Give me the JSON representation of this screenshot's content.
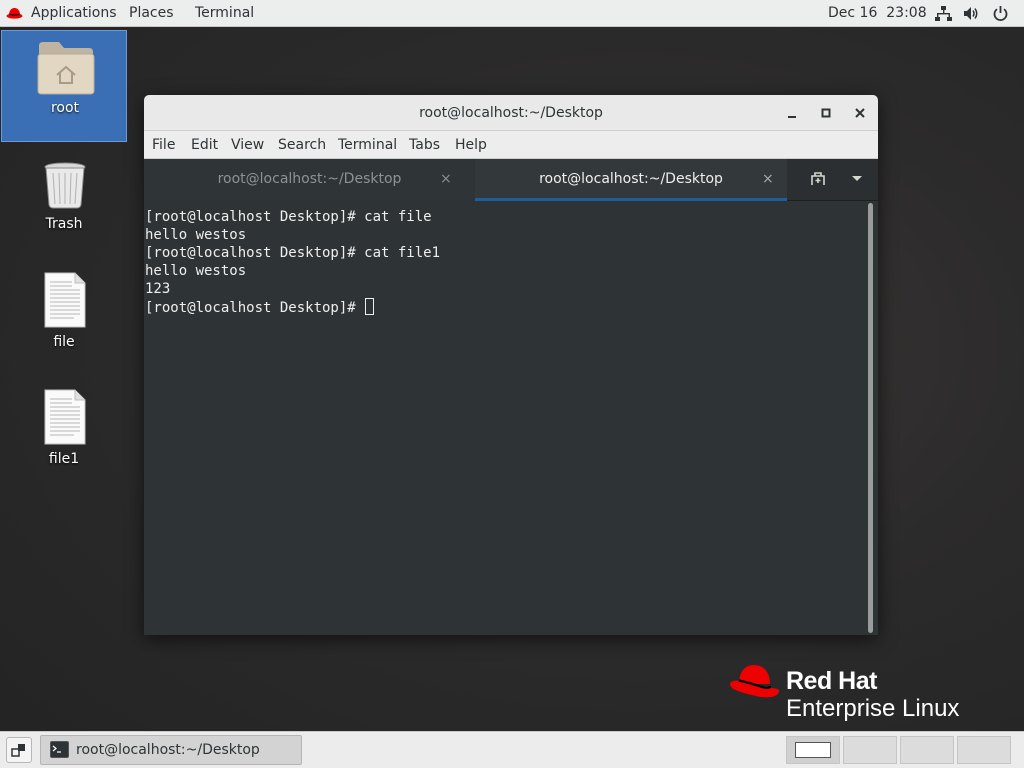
{
  "topbar": {
    "applications": "Applications",
    "places": "Places",
    "terminal": "Terminal",
    "clock": "Dec 16  23:08",
    "icons": [
      "network-icon",
      "volume-icon",
      "power-icon"
    ]
  },
  "desktop": {
    "icons": [
      {
        "label": "root",
        "icon": "home-folder-icon"
      },
      {
        "label": "Trash",
        "icon": "trash-icon"
      },
      {
        "label": "file",
        "icon": "document-icon"
      },
      {
        "label": "file1",
        "icon": "document-icon"
      }
    ]
  },
  "window": {
    "title": "root@localhost:~/Desktop",
    "menu": [
      "File",
      "Edit",
      "View",
      "Search",
      "Terminal",
      "Tabs",
      "Help"
    ],
    "tabs": [
      {
        "label": "root@localhost:~/Desktop",
        "active": false
      },
      {
        "label": "root@localhost:~/Desktop",
        "active": true
      }
    ],
    "close_glyph": "×",
    "terminal_lines": [
      "[root@localhost Desktop]# cat file",
      "hello westos",
      "[root@localhost Desktop]# cat file1",
      "hello westos",
      "123",
      "[root@localhost Desktop]# "
    ]
  },
  "brand": {
    "name": "Red Hat",
    "product": "Enterprise Linux",
    "color": "#ee0000"
  },
  "taskbar": {
    "task_label": "root@localhost:~/Desktop",
    "workspaces": 4
  }
}
